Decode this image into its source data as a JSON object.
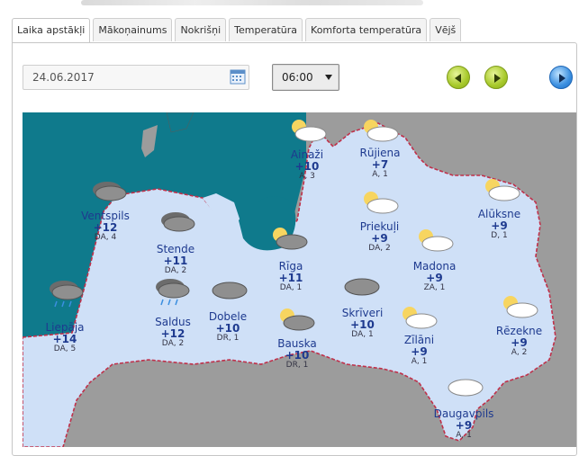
{
  "tabs": [
    {
      "label": "Laika apstākļi",
      "active": true
    },
    {
      "label": "Mākoņainums",
      "active": false
    },
    {
      "label": "Nokrišņi",
      "active": false
    },
    {
      "label": "Temperatūra",
      "active": false
    },
    {
      "label": "Komforta temperatūra",
      "active": false
    },
    {
      "label": "Vējš",
      "active": false
    }
  ],
  "controls": {
    "date_value": "24.06.2017",
    "time_value": "06:00",
    "calendar_icon": "calendar-icon",
    "prev_icon": "arrow-left-icon",
    "next_icon": "arrow-right-icon",
    "play_icon": "play-icon"
  },
  "colors": {
    "sea": "#0f7a8c",
    "land_latvia": "#cfe0f7",
    "land_neighbors": "#9c9c9c",
    "border": "#c0304a",
    "city_text": "#1e3a8f"
  },
  "cities": [
    {
      "name": "Ainaži",
      "temp": "+10",
      "wind": "A, 3",
      "icon": "cloud-sun-icon"
    },
    {
      "name": "Rūjiena",
      "temp": "+7",
      "wind": "A, 1",
      "icon": "cloud-sun-icon"
    },
    {
      "name": "Ventspils",
      "temp": "+12",
      "wind": "DA, 4",
      "icon": "dark-clouds-icon"
    },
    {
      "name": "Stende",
      "temp": "+11",
      "wind": "DA, 2",
      "icon": "dark-clouds-icon"
    },
    {
      "name": "Priekuļi",
      "temp": "+9",
      "wind": "DA, 2",
      "icon": "cloud-sun-icon"
    },
    {
      "name": "Alūksne",
      "temp": "+9",
      "wind": "D, 1",
      "icon": "cloud-sun-icon"
    },
    {
      "name": "Rīga",
      "temp": "+11",
      "wind": "DA, 1",
      "icon": "dark-cloud-sun-icon"
    },
    {
      "name": "Madona",
      "temp": "+9",
      "wind": "ZA, 1",
      "icon": "cloud-sun-icon"
    },
    {
      "name": "Liepāja",
      "temp": "+14",
      "wind": "DA, 5",
      "icon": "rain-cloud-icon"
    },
    {
      "name": "Saldus",
      "temp": "+12",
      "wind": "DA, 2",
      "icon": "rain-cloud-icon"
    },
    {
      "name": "Dobele",
      "temp": "+10",
      "wind": "DR, 1",
      "icon": "dark-cloud-icon"
    },
    {
      "name": "Skrīveri",
      "temp": "+10",
      "wind": "DA, 1",
      "icon": "dark-cloud-icon"
    },
    {
      "name": "Bauska",
      "temp": "+10",
      "wind": "DR, 1",
      "icon": "dark-cloud-sun-icon"
    },
    {
      "name": "Zīlāni",
      "temp": "+9",
      "wind": "A, 1",
      "icon": "cloud-sun-icon"
    },
    {
      "name": "Rēzekne",
      "temp": "+9",
      "wind": "A, 2",
      "icon": "cloud-sun-icon"
    },
    {
      "name": "Daugavpils",
      "temp": "+9",
      "wind": "A, 1",
      "icon": "cloud-icon"
    }
  ]
}
